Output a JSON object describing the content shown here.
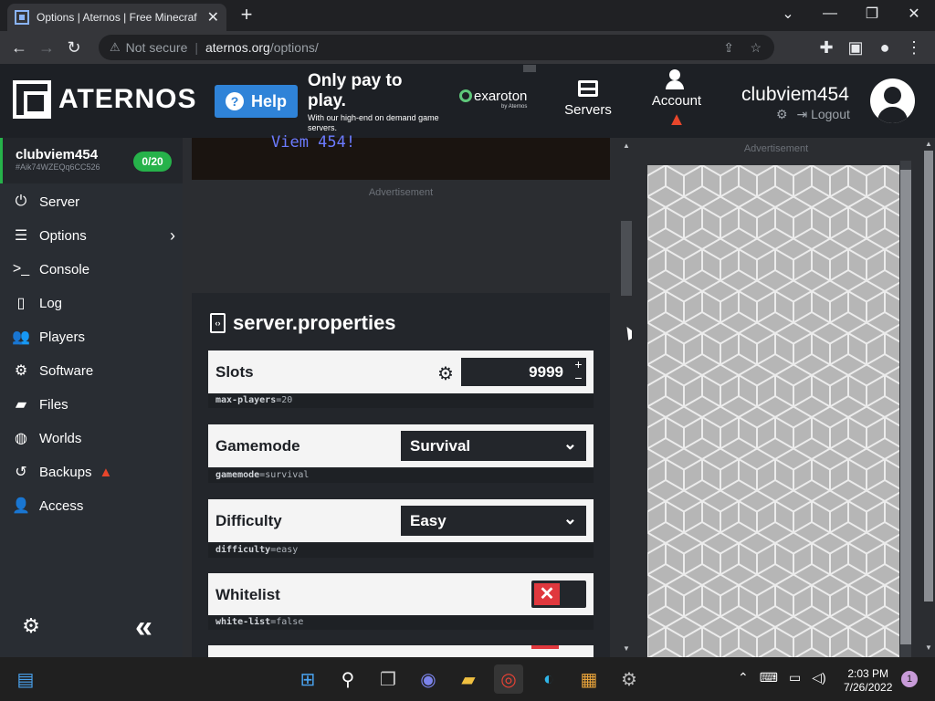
{
  "browser": {
    "tab_title": "Options | Aternos | Free Minecraf",
    "security_label": "Not secure",
    "url_domain": "aternos.org",
    "url_path": "/options/"
  },
  "header": {
    "logo_text": "ATERNOS",
    "help_label": "Help",
    "ad": {
      "headline": "Only pay to play.",
      "subtext": "With our high-end on demand game servers.",
      "brand": "exaroton",
      "brand_by": "by Aternos"
    },
    "servers_label": "Servers",
    "account_label": "Account",
    "username": "clubviem454",
    "logout_label": "Logout"
  },
  "sidebar": {
    "server_name": "clubviem454",
    "server_id": "#Aik74WZEQq6CC526",
    "player_count": "0/20",
    "items": [
      {
        "label": "Server",
        "icon": "power-icon"
      },
      {
        "label": "Options",
        "icon": "sliders-icon"
      },
      {
        "label": "Console",
        "icon": "terminal-icon"
      },
      {
        "label": "Log",
        "icon": "file-icon"
      },
      {
        "label": "Players",
        "icon": "users-icon"
      },
      {
        "label": "Software",
        "icon": "cogs-icon"
      },
      {
        "label": "Files",
        "icon": "folder-icon"
      },
      {
        "label": "Worlds",
        "icon": "globe-icon"
      },
      {
        "label": "Backups",
        "icon": "history-icon"
      },
      {
        "label": "Access",
        "icon": "user-lock-icon"
      }
    ]
  },
  "main": {
    "banner_text": "Viem 454!",
    "ad_label": "Advertisement",
    "panel_title": "server.properties",
    "slots": {
      "label": "Slots",
      "value": "9999",
      "key": "max-players",
      "key_value": "20"
    },
    "gamemode": {
      "label": "Gamemode",
      "value": "Survival",
      "key": "gamemode",
      "key_value": "survival"
    },
    "difficulty": {
      "label": "Difficulty",
      "value": "Easy",
      "key": "difficulty",
      "key_value": "easy"
    },
    "whitelist": {
      "label": "Whitelist",
      "key": "white-list",
      "key_value": "false"
    }
  },
  "right_ad": {
    "label": "Advertisement"
  },
  "taskbar": {
    "time": "2:03 PM",
    "date": "7/26/2022",
    "notifications": "1"
  },
  "colors": {
    "accent_green": "#26b24a",
    "help_blue": "#2f83d8",
    "toggle_red": "#e0383e"
  }
}
